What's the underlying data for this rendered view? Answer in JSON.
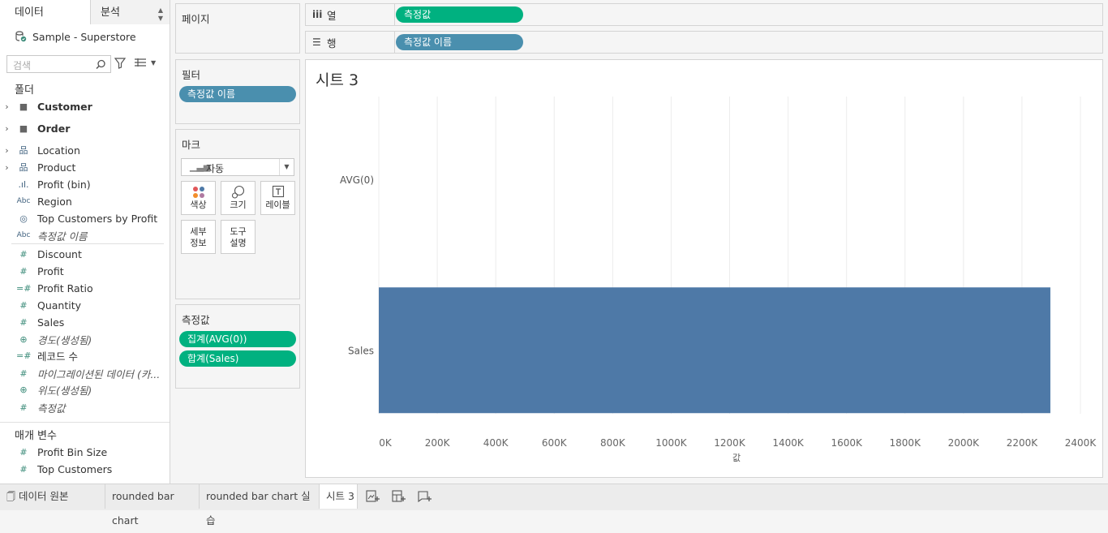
{
  "left_pane": {
    "tab_data": "데이터",
    "tab_analysis": "분석",
    "data_source": "Sample - Superstore",
    "search_placeholder": "검색",
    "folders_header": "폴더",
    "folders": [
      {
        "label": "Customer",
        "icon": "folder-icon"
      },
      {
        "label": "Order",
        "icon": "folder-icon"
      }
    ],
    "dimensions": [
      {
        "label": "Location",
        "icon": "hierarchy-icon"
      },
      {
        "label": "Product",
        "icon": "hierarchy-icon"
      },
      {
        "label": "Profit (bin)",
        "icon": "bin-icon"
      },
      {
        "label": "Region",
        "icon": "abc-icon"
      },
      {
        "label": "Top Customers by Profit",
        "icon": "set-icon"
      },
      {
        "label": "측정값 이름",
        "icon": "abc-icon"
      }
    ],
    "measures": [
      {
        "label": "Discount",
        "icon": "number-icon"
      },
      {
        "label": "Profit",
        "icon": "number-icon"
      },
      {
        "label": "Profit Ratio",
        "icon": "calc-number-icon"
      },
      {
        "label": "Quantity",
        "icon": "number-icon"
      },
      {
        "label": "Sales",
        "icon": "number-icon"
      },
      {
        "label": "경도(생성됨)",
        "icon": "globe-icon"
      },
      {
        "label": "레코드 수",
        "icon": "calc-number-icon"
      },
      {
        "label": "마이그레이션된 데이터 (카...",
        "icon": "number-icon"
      },
      {
        "label": "위도(생성됨)",
        "icon": "globe-icon"
      },
      {
        "label": "측정값",
        "icon": "number-icon"
      }
    ],
    "params_header": "매개 변수",
    "params": [
      {
        "label": "Profit Bin Size",
        "icon": "number-icon"
      },
      {
        "label": "Top Customers",
        "icon": "number-icon"
      }
    ]
  },
  "pages_card": {
    "title": "페이지"
  },
  "filters_card": {
    "title": "필터",
    "pills": [
      "측정값 이름"
    ]
  },
  "marks_card": {
    "title": "마크",
    "type": "자동",
    "buttons": {
      "color": "색상",
      "size": "크기",
      "label": "레이블",
      "detail": "세부\n정보",
      "tooltip": "도구\n설명"
    }
  },
  "measure_values_card": {
    "title": "측정값",
    "pills": [
      "집계(AVG(0))",
      "합계(Sales)"
    ]
  },
  "columns_shelf": {
    "label": "열",
    "pill": "측정값"
  },
  "rows_shelf": {
    "label": "행",
    "pill": "측정값 이름"
  },
  "sheet": {
    "title": "시트 3"
  },
  "chart_data": {
    "type": "bar",
    "orientation": "horizontal",
    "categories": [
      "AVG(0)",
      "Sales"
    ],
    "values": [
      0,
      2297201
    ],
    "xlabel": "값",
    "ylabel": "",
    "xlim": [
      0,
      2400000
    ],
    "x_ticks": [
      "0K",
      "200K",
      "400K",
      "600K",
      "800K",
      "1000K",
      "1200K",
      "1400K",
      "1600K",
      "1800K",
      "2000K",
      "2200K",
      "2400K"
    ],
    "grid": "vertical",
    "bar_color": "#4e79a7"
  },
  "bottom_tabs": {
    "data_source": "데이터 원본",
    "sheets": [
      "rounded bar chart",
      "rounded bar chart 실습",
      "시트 3"
    ]
  },
  "colors": {
    "dimension_pill": "#4a8fae",
    "measure_pill": "#00b180"
  }
}
